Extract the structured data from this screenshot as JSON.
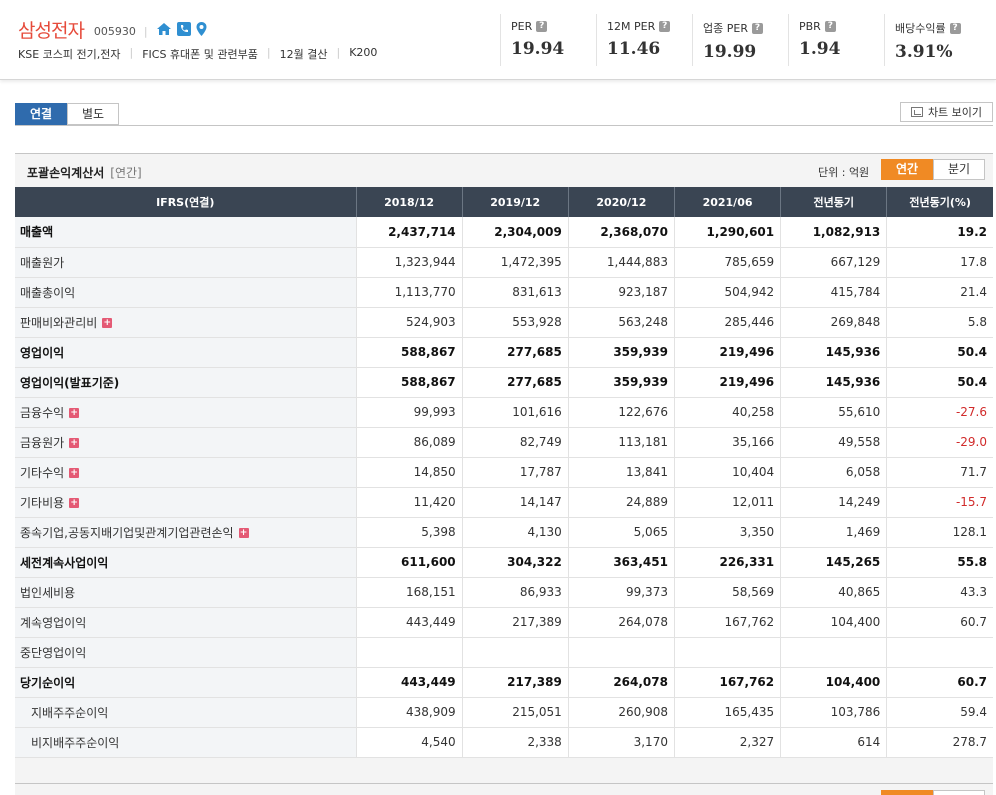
{
  "company": {
    "name": "삼성전자",
    "code": "005930",
    "meta": [
      "KSE 코스피 전기,전자",
      "FICS 휴대폰 및 관련부품",
      "12월 결산",
      "K200"
    ]
  },
  "metrics": [
    {
      "label": "PER",
      "value": "19.94"
    },
    {
      "label": "12M PER",
      "value": "11.46"
    },
    {
      "label": "업종 PER",
      "value": "19.99"
    },
    {
      "label": "PBR",
      "value": "1.94"
    },
    {
      "label": "배당수익률",
      "value": "3.91%"
    }
  ],
  "tabs": {
    "consolidated": "연결",
    "separate": "별도"
  },
  "chart_button": "차트 보이기",
  "section": {
    "title": "포괄손익계산서",
    "subtitle": "[연간]",
    "unit": "단위 : 억원",
    "toggle_annual": "연간",
    "toggle_quarter": "분기"
  },
  "table": {
    "headers": [
      "IFRS(연결)",
      "2018/12",
      "2019/12",
      "2020/12",
      "2021/06",
      "전년동기",
      "전년동기(%)"
    ],
    "rows": [
      {
        "name": "매출액",
        "bold": true,
        "values": [
          "2,437,714",
          "2,304,009",
          "2,368,070",
          "1,290,601",
          "1,082,913",
          "19.2"
        ]
      },
      {
        "name": "매출원가",
        "values": [
          "1,323,944",
          "1,472,395",
          "1,444,883",
          "785,659",
          "667,129",
          "17.8"
        ]
      },
      {
        "name": "매출총이익",
        "values": [
          "1,113,770",
          "831,613",
          "923,187",
          "504,942",
          "415,784",
          "21.4"
        ]
      },
      {
        "name": "판매비와관리비",
        "plus": true,
        "values": [
          "524,903",
          "553,928",
          "563,248",
          "285,446",
          "269,848",
          "5.8"
        ]
      },
      {
        "name": "영업이익",
        "bold": true,
        "border": true,
        "values": [
          "588,867",
          "277,685",
          "359,939",
          "219,496",
          "145,936",
          "50.4"
        ]
      },
      {
        "name": "영업이익(발표기준)",
        "bold": true,
        "values": [
          "588,867",
          "277,685",
          "359,939",
          "219,496",
          "145,936",
          "50.4"
        ]
      },
      {
        "name": "금융수익",
        "plus": true,
        "border": true,
        "values": [
          "99,993",
          "101,616",
          "122,676",
          "40,258",
          "55,610",
          "-27.6"
        ]
      },
      {
        "name": "금융원가",
        "plus": true,
        "values": [
          "86,089",
          "82,749",
          "113,181",
          "35,166",
          "49,558",
          "-29.0"
        ]
      },
      {
        "name": "기타수익",
        "plus": true,
        "values": [
          "14,850",
          "17,787",
          "13,841",
          "10,404",
          "6,058",
          "71.7"
        ]
      },
      {
        "name": "기타비용",
        "plus": true,
        "values": [
          "11,420",
          "14,147",
          "24,889",
          "12,011",
          "14,249",
          "-15.7"
        ]
      },
      {
        "name": "종속기업,공동지배기업및관계기업관련손익",
        "plus": true,
        "values": [
          "5,398",
          "4,130",
          "5,065",
          "3,350",
          "1,469",
          "128.1"
        ]
      },
      {
        "name": "세전계속사업이익",
        "bold": true,
        "border": true,
        "values": [
          "611,600",
          "304,322",
          "363,451",
          "226,331",
          "145,265",
          "55.8"
        ]
      },
      {
        "name": "법인세비용",
        "values": [
          "168,151",
          "86,933",
          "99,373",
          "58,569",
          "40,865",
          "43.3"
        ]
      },
      {
        "name": "계속영업이익",
        "values": [
          "443,449",
          "217,389",
          "264,078",
          "167,762",
          "104,400",
          "60.7"
        ]
      },
      {
        "name": "중단영업이익",
        "values": [
          "",
          "",
          "",
          "",
          "",
          ""
        ]
      },
      {
        "name": "당기순이익",
        "bold": true,
        "border": true,
        "values": [
          "443,449",
          "217,389",
          "264,078",
          "167,762",
          "104,400",
          "60.7"
        ]
      },
      {
        "name": "지배주주순이익",
        "indent": true,
        "values": [
          "438,909",
          "215,051",
          "260,908",
          "165,435",
          "103,786",
          "59.4"
        ]
      },
      {
        "name": "비지배주주순이익",
        "indent": true,
        "values": [
          "4,540",
          "2,338",
          "3,170",
          "2,327",
          "614",
          "278.7"
        ]
      }
    ]
  },
  "colors": {
    "brand_red": "#e64b3b",
    "tab_blue": "#2f6bad",
    "toggle_orange": "#f08a24",
    "header_dark": "#3a4553",
    "negative": "#d12b2b"
  }
}
